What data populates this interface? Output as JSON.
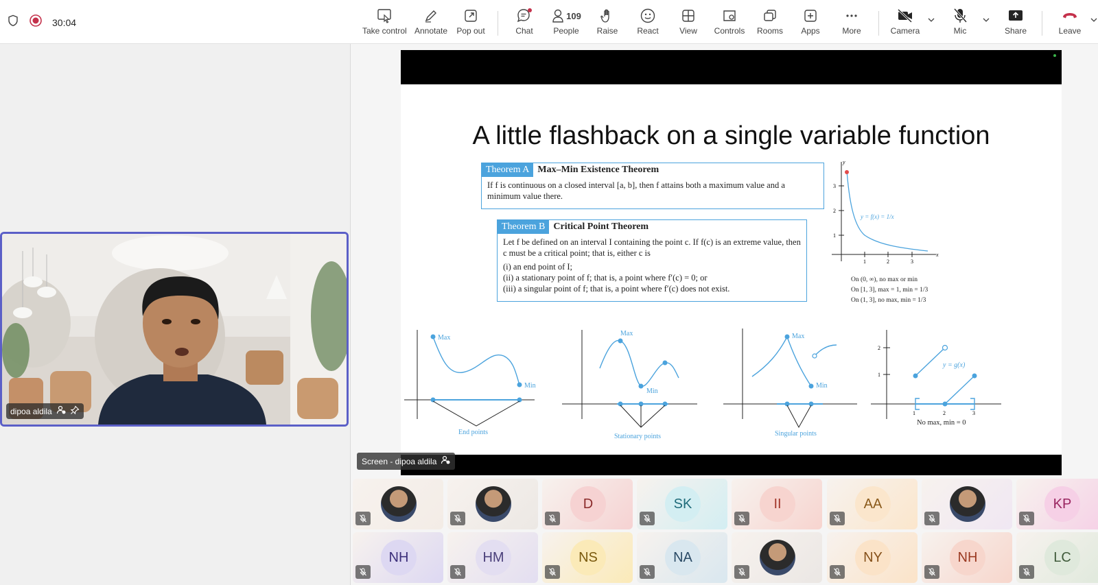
{
  "toolbar": {
    "timer": "30:04",
    "take_control": "Take control",
    "annotate": "Annotate",
    "pop_out": "Pop out",
    "chat": "Chat",
    "people": "People",
    "people_count": "109",
    "raise": "Raise",
    "react": "React",
    "view": "View",
    "controls": "Controls",
    "rooms": "Rooms",
    "apps": "Apps",
    "more": "More",
    "camera": "Camera",
    "mic": "Mic",
    "share": "Share",
    "leave": "Leave"
  },
  "self_view": {
    "name": "dipoa aldila"
  },
  "screen_share": {
    "label": "Screen - dipoa aldila"
  },
  "slide": {
    "title": "A little flashback on a single variable function",
    "theorem_a": {
      "tag": "Theorem A",
      "name": "Max–Min Existence Theorem",
      "body": "If f is continuous on a closed interval [a, b], then f attains both a maximum value and a minimum value there."
    },
    "theorem_b": {
      "tag": "Theorem B",
      "name": "Critical Point Theorem",
      "body": "Let f be defined on an interval I containing the point c. If f(c) is an extreme value, then c must be a critical point; that is, either c is",
      "items": [
        "(i)  an end point of I;",
        "(ii)  a stationary point of f; that is, a point where f′(c) = 0; or",
        "(iii)  a singular point of f; that is, a point where f′(c) does not exist."
      ]
    },
    "graph_fn": "y = f(x) = 1/x",
    "graph_notes": [
      "On (0, ∞), no max or min",
      "On [1, 3], max = 1, min = 1/3",
      "On (1, 3], no max, min = 1/3"
    ],
    "panel_labels": {
      "end_points": "End points",
      "stationary_points": "Stationary points",
      "singular_points": "Singular points",
      "gx_caption": "No max, min = 0",
      "gx": "y = g(x)",
      "max": "Max",
      "min": "Min"
    }
  },
  "participants": [
    {
      "initials": "",
      "bg": "#f3ece6",
      "color": "#333",
      "photo": true
    },
    {
      "initials": "",
      "bg": "#ece8e4",
      "color": "#333",
      "photo": true
    },
    {
      "initials": "D",
      "bg": "#f6d2d2",
      "color": "#8b2b2b"
    },
    {
      "initials": "SK",
      "bg": "#d3eef2",
      "color": "#1f6b7a"
    },
    {
      "initials": "II",
      "bg": "#f7d4cf",
      "color": "#a3372b"
    },
    {
      "initials": "AA",
      "bg": "#fbe6cc",
      "color": "#8a5a1b"
    },
    {
      "initials": "",
      "bg": "#f0e7f3",
      "color": "#333",
      "photo": true
    },
    {
      "initials": "KP",
      "bg": "#f6d0e6",
      "color": "#99235f"
    },
    {
      "initials": "NH",
      "bg": "#ddd8f2",
      "color": "#3c2f7a"
    },
    {
      "initials": "HM",
      "bg": "#e3def1",
      "color": "#4a3f7a"
    },
    {
      "initials": "NS",
      "bg": "#fbeab8",
      "color": "#7a5a0e"
    },
    {
      "initials": "NA",
      "bg": "#d9e7ef",
      "color": "#2b4b66"
    },
    {
      "initials": "",
      "bg": "#ebe7e4",
      "color": "#333",
      "photo": true
    },
    {
      "initials": "NY",
      "bg": "#fbe3c8",
      "color": "#86511b"
    },
    {
      "initials": "NH",
      "bg": "#f7d6cc",
      "color": "#9a3a22"
    },
    {
      "initials": "LC",
      "bg": "#dfe9dc",
      "color": "#3f5a3a"
    }
  ]
}
